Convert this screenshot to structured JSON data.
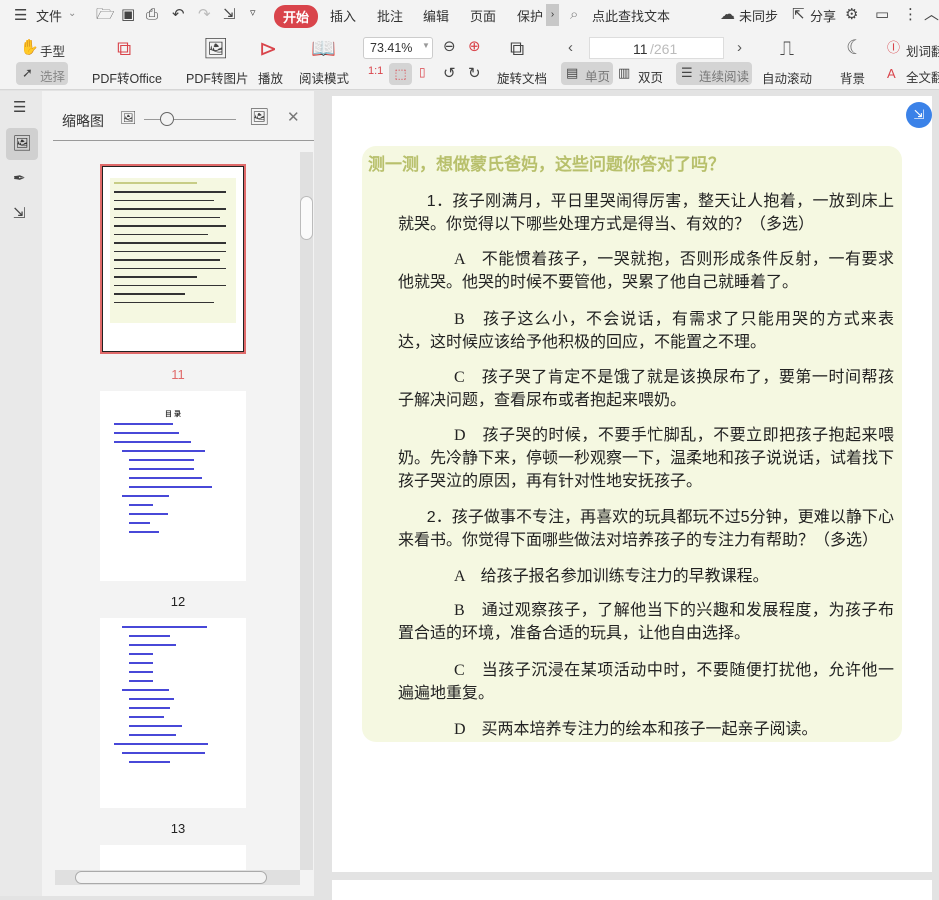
{
  "menu": {
    "file": "文件",
    "tabs": [
      "开始",
      "插入",
      "批注",
      "编辑",
      "页面",
      "保护"
    ],
    "search": "点此查找文本",
    "sync": "未同步",
    "share": "分享"
  },
  "toolbar": {
    "hand": "手型",
    "select": "选择",
    "pdf_office": "PDF转Office",
    "pdf_image": "PDF转图片",
    "play": "播放",
    "read_mode": "阅读模式",
    "zoom": "73.41%",
    "rotate": "旋转文档",
    "page_current": "11",
    "page_total": "/261",
    "single": "单页",
    "double": "双页",
    "continuous": "连续阅读",
    "auto_scroll": "自动滚动",
    "background": "背景",
    "word_translate": "划词翻",
    "full_translate": "全文翻"
  },
  "panel": {
    "title": "缩略图",
    "thumb_labels": [
      "11",
      "12",
      "13"
    ],
    "toc_title": "目 录"
  },
  "doc": {
    "title": "测一测，想做蒙氏爸妈，这些问题你答对了吗？",
    "paragraphs": [
      {
        "type": "q",
        "text": "1．孩子刚满月，平日里哭闹得厉害，整天让人抱着，一放到床上就哭。你觉得以下哪些处理方式是得当、有效的？（多选）"
      },
      {
        "type": "s",
        "text": "A　不能惯着孩子，一哭就抱，否则形成条件反射，一有要求他就哭。他哭的时候不要管他，哭累了他自己就睡着了。"
      },
      {
        "type": "s",
        "text": "B　孩子这么小，不会说话，有需求了只能用哭的方式来表达，这时候应该给予他积极的回应，不能置之不理。"
      },
      {
        "type": "s",
        "text": "C　孩子哭了肯定不是饿了就是该换尿布了，要第一时间帮孩子解决问题，查看尿布或者抱起来喂奶。"
      },
      {
        "type": "s",
        "text": "D　孩子哭的时候，不要手忙脚乱，不要立即把孩子抱起来喂奶。先冷静下来，停顿一秒观察一下，温柔地和孩子说说话，试着找下孩子哭泣的原因，再有针对性地安抚孩子。"
      },
      {
        "type": "q",
        "text": "2．孩子做事不专注，再喜欢的玩具都玩不过5分钟，更难以静下心来看书。你觉得下面哪些做法对培养孩子的专注力有帮助？（多选）"
      },
      {
        "type": "s",
        "text": "A　给孩子报名参加训练专注力的早教课程。"
      },
      {
        "type": "s",
        "text": "B　通过观察孩子，了解他当下的兴趣和发展程度，为孩子布置合适的环境，准备合适的玩具，让他自由选择。"
      },
      {
        "type": "s",
        "text": "C　当孩子沉浸在某项活动中时，不要随便打扰他，允许他一遍遍地重复。"
      },
      {
        "type": "s",
        "text": "D　买两本培养专注力的绘本和孩子一起亲子阅读。"
      }
    ]
  },
  "colors": {
    "accent": "#d9444b",
    "title_green": "#b8c06c",
    "box_bg": "#f5f8e1",
    "fab": "#3b82e8"
  }
}
